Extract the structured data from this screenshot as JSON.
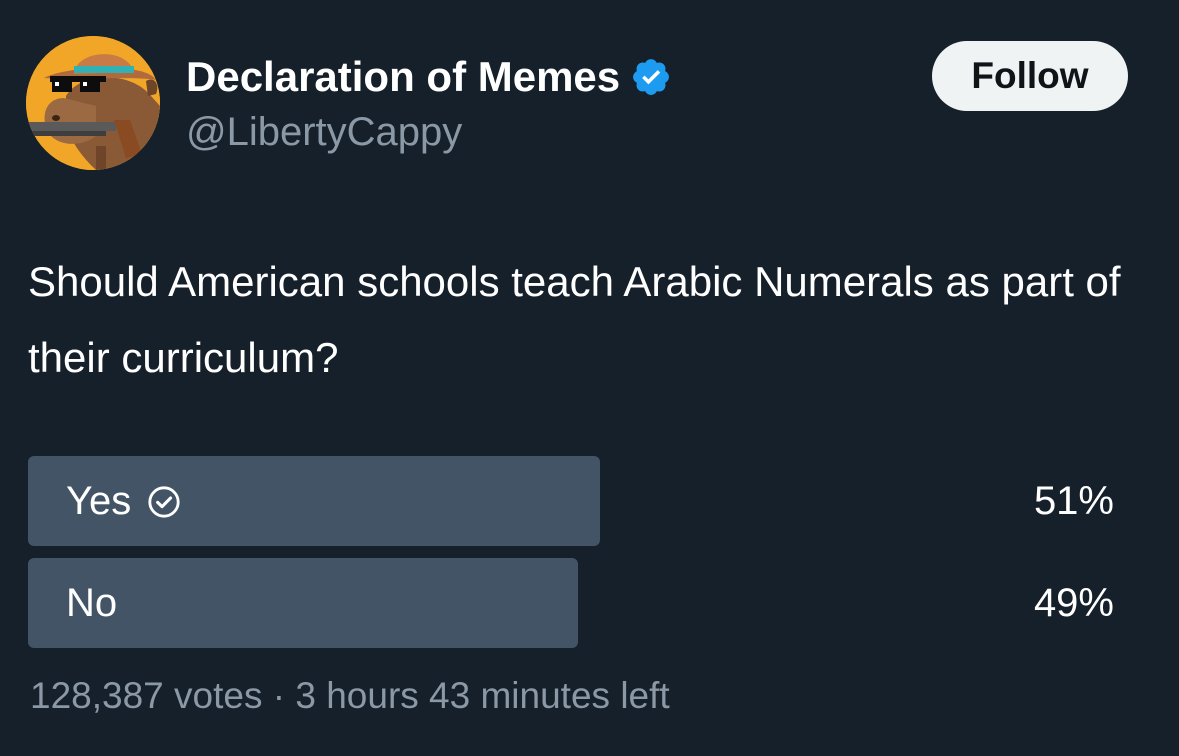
{
  "author": {
    "display_name": "Declaration of Memes",
    "handle": "@LibertyCappy",
    "verified": true
  },
  "follow_label": "Follow",
  "tweet_text": "Should American schools teach Arabic Numerals as part of their curriculum?",
  "poll": {
    "options": [
      {
        "label": "Yes",
        "percent_label": "51%",
        "percent": 51,
        "selected": true
      },
      {
        "label": "No",
        "percent_label": "49%",
        "percent": 49,
        "selected": false
      }
    ],
    "votes": "128,387 votes",
    "separator": "·",
    "time_left": "3 hours 43 minutes left"
  },
  "icons": {
    "verified": "verified-badge-icon",
    "selected": "check-circle-icon"
  },
  "colors": {
    "background": "#16202b",
    "poll_bar": "#425466",
    "verified": "#1d9bf0",
    "secondary_text": "#8b98a5",
    "follow_button": "#eff3f4"
  }
}
